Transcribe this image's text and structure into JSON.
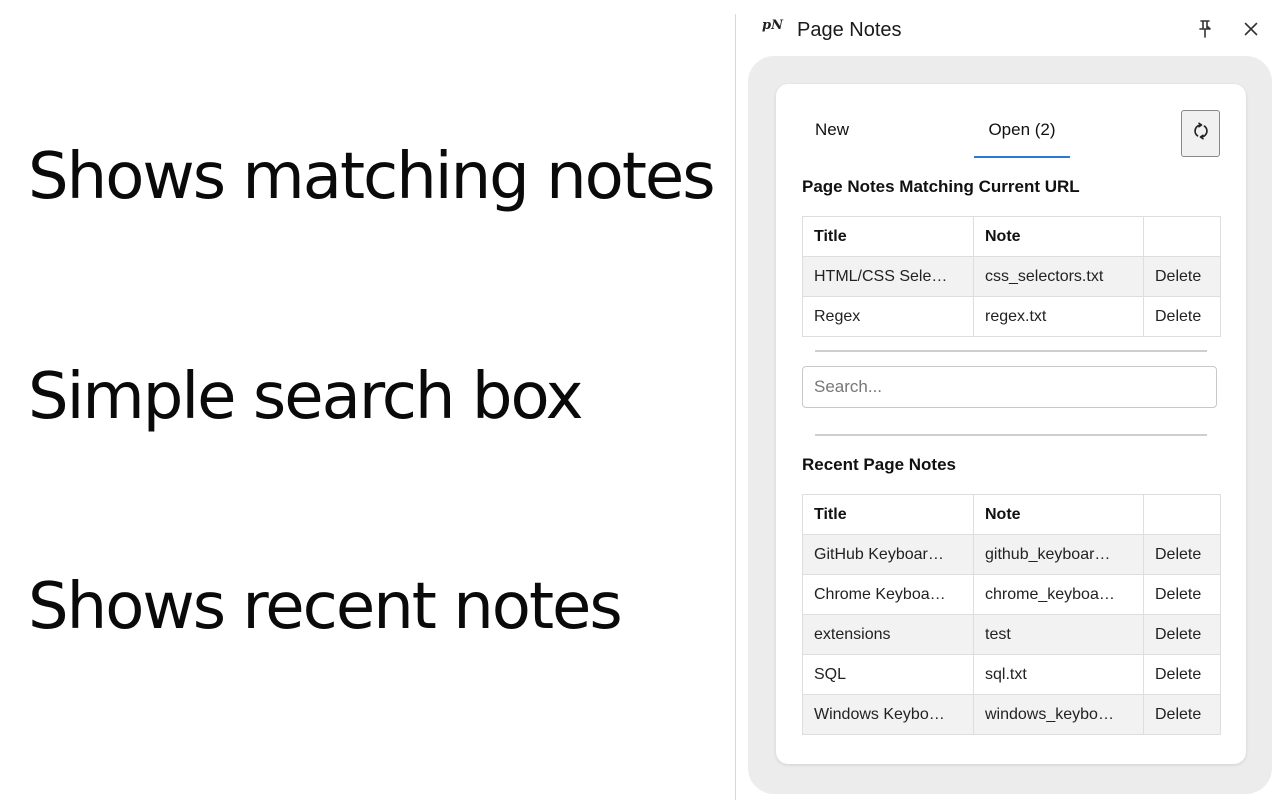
{
  "captions": [
    "Shows matching notes",
    "Simple search box",
    "Shows recent notes"
  ],
  "panel": {
    "logo": "pN",
    "title": "Page Notes",
    "pin_icon": "pin-icon",
    "close_icon": "close-icon"
  },
  "tabs": [
    {
      "label": "New",
      "active": false
    },
    {
      "label": "Open (2)",
      "active": true
    }
  ],
  "refresh_icon": "refresh-icon",
  "accent_color": "#2b79d6",
  "matching": {
    "heading": "Page Notes Matching Current URL",
    "columns": [
      "Title",
      "Note",
      ""
    ],
    "rows": [
      {
        "title": "HTML/CSS Sele…",
        "note": "css_selectors.txt",
        "action": "Delete"
      },
      {
        "title": "Regex",
        "note": "regex.txt",
        "action": "Delete"
      }
    ]
  },
  "search": {
    "placeholder": "Search...",
    "value": ""
  },
  "recent": {
    "heading": "Recent Page Notes",
    "columns": [
      "Title",
      "Note",
      ""
    ],
    "rows": [
      {
        "title": "GitHub Keyboar…",
        "note": "github_keyboar…",
        "action": "Delete"
      },
      {
        "title": "Chrome Keyboa…",
        "note": "chrome_keyboa…",
        "action": "Delete"
      },
      {
        "title": "extensions",
        "note": "test",
        "action": "Delete"
      },
      {
        "title": "SQL",
        "note": "sql.txt",
        "action": "Delete"
      },
      {
        "title": "Windows Keybo…",
        "note": "windows_keybo…",
        "action": "Delete"
      }
    ]
  }
}
